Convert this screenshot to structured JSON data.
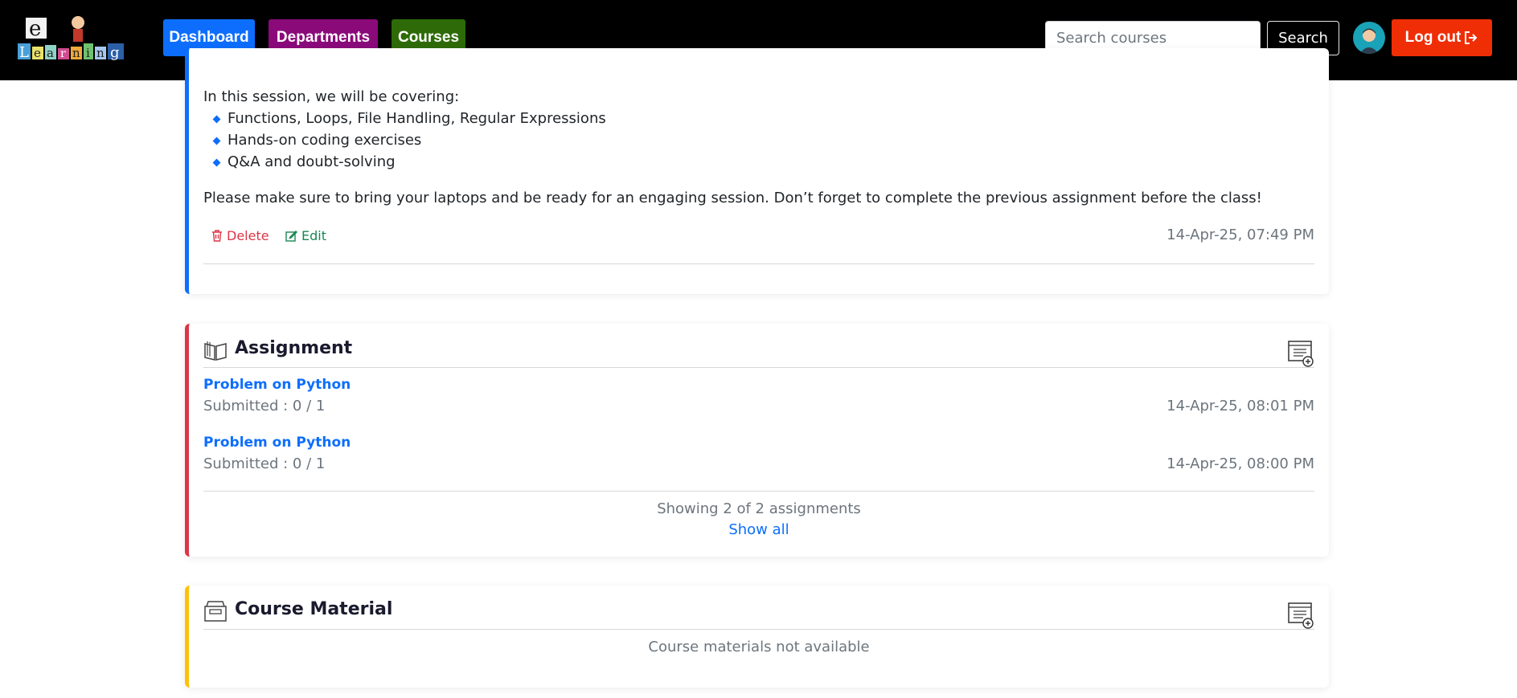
{
  "nav": {
    "logo_letters": [
      "e",
      "L",
      "e",
      "a",
      "r",
      "n",
      "i",
      "n",
      "g"
    ],
    "dashboard": "Dashboard",
    "departments": "Departments",
    "courses": "Courses",
    "search_placeholder": "Search courses",
    "search_button": "Search",
    "logout": "Log out"
  },
  "announcement": {
    "intro": "In this session, we will be covering:",
    "bullets": [
      "Functions, Loops, File Handling, Regular Expressions",
      "Hands-on coding exercises",
      "Q&A and doubt-solving"
    ],
    "note": "Please make sure to bring your laptops and be ready for an engaging session. Don’t forget to complete the previous assignment before the class!",
    "delete_label": "Delete",
    "edit_label": "Edit",
    "timestamp": "14-Apr-25, 07:49 PM"
  },
  "assignment": {
    "title": "Assignment",
    "items": [
      {
        "name": "Problem on Python",
        "submitted": "Submitted : 0 / 1",
        "timestamp": "14-Apr-25, 08:01 PM"
      },
      {
        "name": "Problem on Python",
        "submitted": "Submitted : 0 / 1",
        "timestamp": "14-Apr-25, 08:00 PM"
      }
    ],
    "summary": "Showing 2 of 2 assignments",
    "show_all": "Show all"
  },
  "material": {
    "title": "Course Material",
    "empty": "Course materials not available"
  },
  "colors": {
    "dashboard": "#0d6efd",
    "departments": "#8a0a7a",
    "courses": "#2e6b08",
    "logout": "#ef2e06",
    "announcement_accent": "#0d6efd",
    "assignment_accent": "#dc3545",
    "material_accent": "#ffc107"
  }
}
